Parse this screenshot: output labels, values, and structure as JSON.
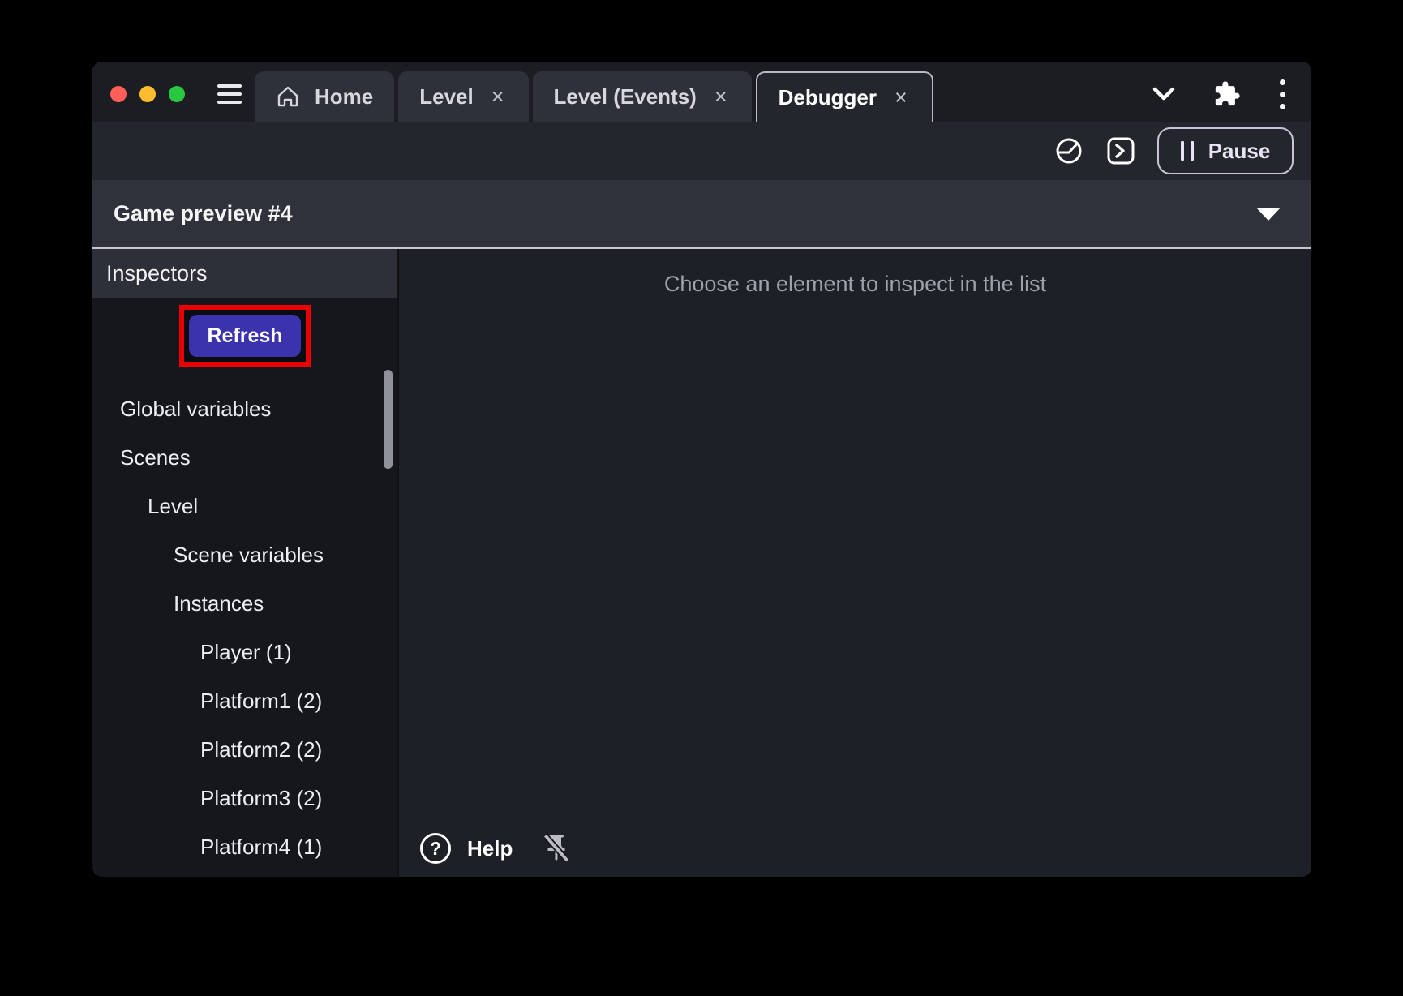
{
  "titlebar": {
    "tabs": [
      {
        "label": "Home",
        "active": false,
        "closable": false
      },
      {
        "label": "Level",
        "active": false,
        "closable": true
      },
      {
        "label": "Level (Events)",
        "active": false,
        "closable": true
      },
      {
        "label": "Debugger",
        "active": true,
        "closable": true
      }
    ]
  },
  "toolbar": {
    "pause_label": "Pause"
  },
  "preview_bar": {
    "label": "Game preview #4"
  },
  "sidebar": {
    "header": "Inspectors",
    "refresh_button": "Refresh",
    "tree": [
      {
        "label": "Global variables",
        "level": 1
      },
      {
        "label": "Scenes",
        "level": 1
      },
      {
        "label": "Level",
        "level": 2
      },
      {
        "label": "Scene variables",
        "level": 3
      },
      {
        "label": "Instances",
        "level": 3
      },
      {
        "label": "Player (1)",
        "level": 4
      },
      {
        "label": "Platform1 (2)",
        "level": 4
      },
      {
        "label": "Platform2 (2)",
        "level": 4
      },
      {
        "label": "Platform3 (2)",
        "level": 4
      },
      {
        "label": "Platform4 (1)",
        "level": 4
      }
    ]
  },
  "main": {
    "empty_message": "Choose an element to inspect in the list",
    "help_label": "Help"
  },
  "icons": {
    "close_glyph": "×",
    "help_glyph": "?"
  },
  "colors": {
    "traffic_red": "#ff5f57",
    "traffic_yellow": "#febc2e",
    "traffic_green": "#28c840",
    "refresh_button_bg": "#3b33ad",
    "annotation_red": "#ea0000",
    "pause_accent": "#e9e4f4"
  }
}
